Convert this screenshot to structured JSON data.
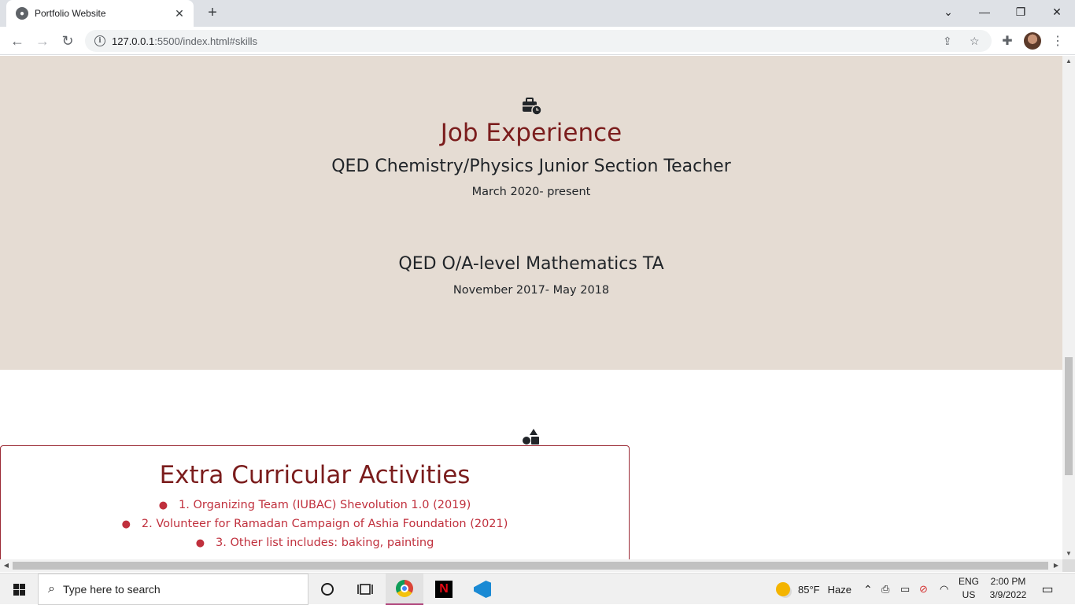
{
  "browser": {
    "tab_title": "Portfolio Website",
    "url_host": "127.0.0.1",
    "url_rest": ":5500/index.html#skills"
  },
  "job": {
    "heading": "Job Experience",
    "items": [
      {
        "role": "QED Chemistry/Physics Junior Section Teacher",
        "dates": "March 2020- present"
      },
      {
        "role": "QED O/A-level Mathematics TA",
        "dates": "November 2017- May 2018"
      }
    ]
  },
  "extra": {
    "heading": "Extra Curricular Activities",
    "items": [
      "1. Organizing Team (IUBAC) Shevolution 1.0 (2019)",
      "2. Volunteer for Ramadan Campaign of Ashia Foundation (2021)",
      "3. Other list includes: baking, painting"
    ]
  },
  "taskbar": {
    "search_placeholder": "Type here to search",
    "weather": "85°F",
    "weather_desc": "Haze",
    "lang_top": "ENG",
    "lang_bottom": "US",
    "time": "2:00 PM",
    "date": "3/9/2022"
  },
  "colors": {
    "job_bg": "#e5dcd3",
    "heading": "#7b1d1d",
    "list_text": "#c0303d",
    "box_border": "#9b2a35"
  },
  "icons": [
    "briefcase-clock-icon",
    "shapes-icon",
    "info-icon",
    "share-icon",
    "star-icon",
    "extensions-icon",
    "kebab-menu-icon"
  ]
}
